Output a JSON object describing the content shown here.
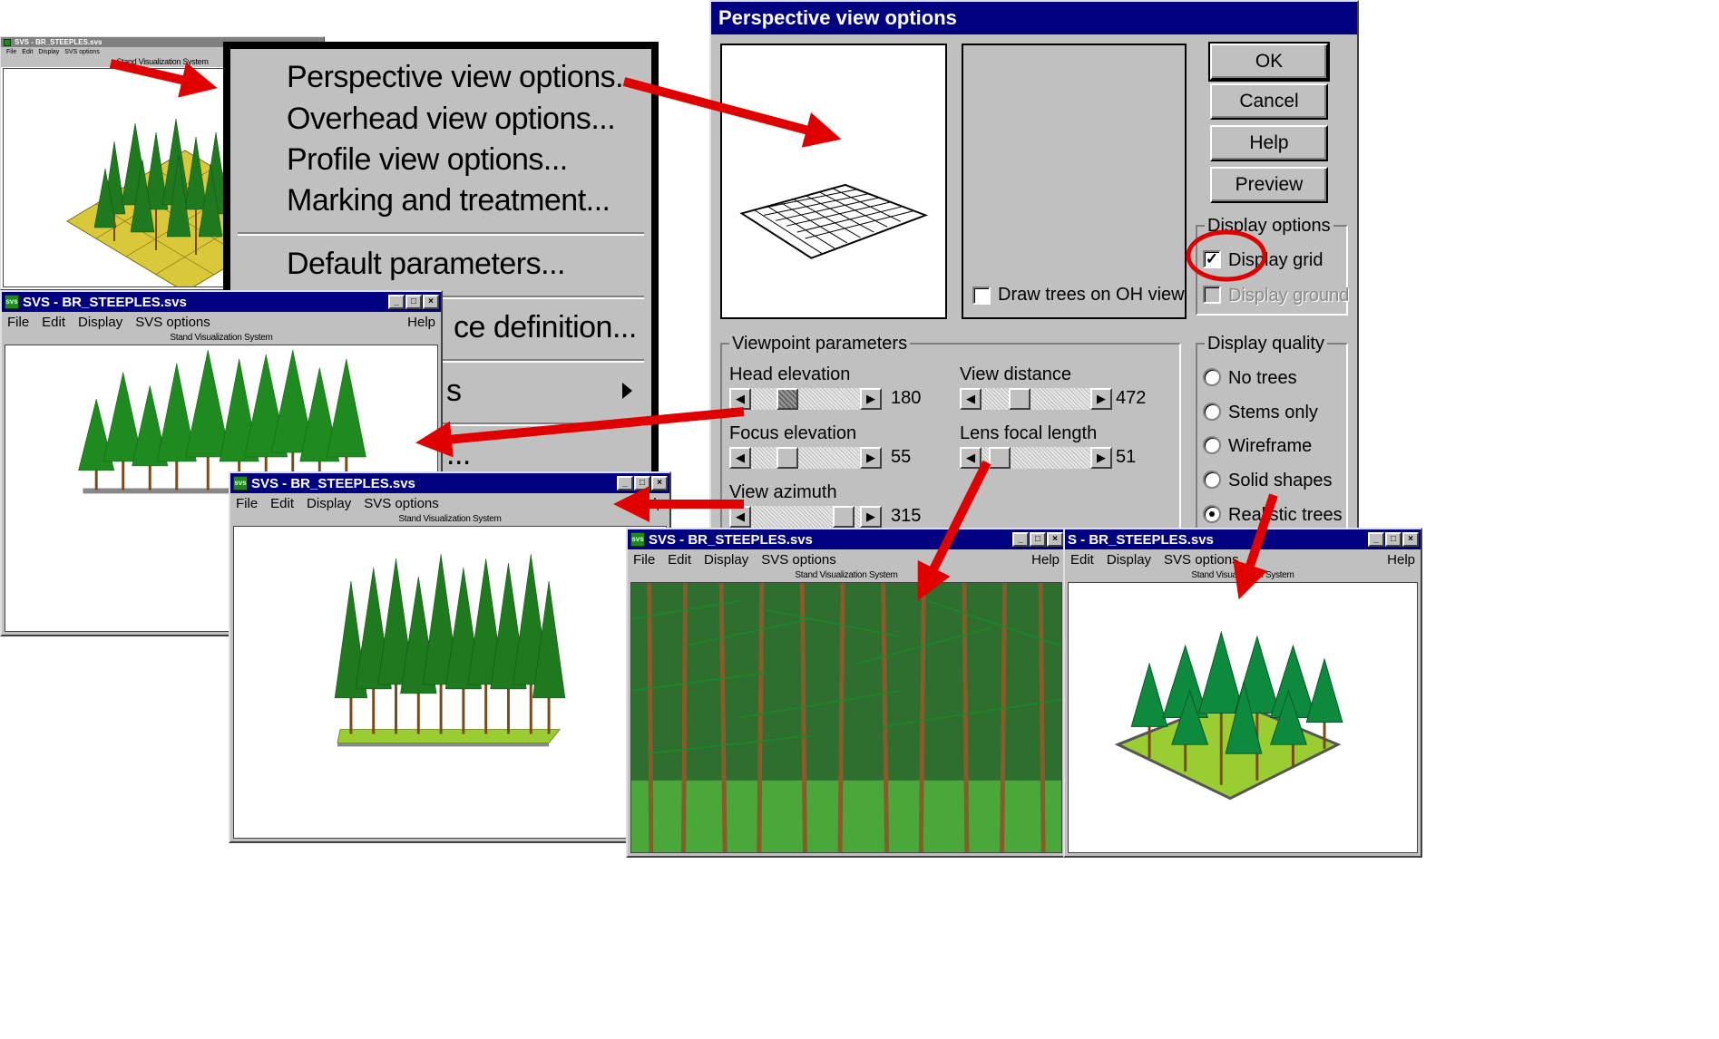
{
  "app": {
    "title": "SVS - BR_STEEPLES.svs",
    "subtitle": "Stand Visualization System",
    "title_cut": "S - BR_STEEPLES.svs"
  },
  "menubar": {
    "file": "File",
    "edit": "Edit",
    "display": "Display",
    "svs_options": "SVS options",
    "help": "Help",
    "edit_cut": "Edit"
  },
  "display_menu": {
    "items": [
      "Perspective view options...",
      "Overhead view options...",
      "Profile view options...",
      "Marking and treatment...",
      "Default parameters...",
      "ce definition...",
      "s",
      "..."
    ]
  },
  "dialog": {
    "title": "Perspective view options",
    "buttons": {
      "ok": "OK",
      "cancel": "Cancel",
      "help": "Help",
      "preview": "Preview"
    },
    "draw_trees_oh": "Draw trees on OH view",
    "display_options": {
      "label": "Display options",
      "grid": "Display grid",
      "ground": "Display ground",
      "grid_checked": true,
      "ground_checked": false
    },
    "viewpoint": {
      "label": "Viewpoint parameters",
      "head_elevation": {
        "label": "Head elevation",
        "value": "180"
      },
      "focus_elevation": {
        "label": "Focus elevation",
        "value": "55"
      },
      "view_azimuth": {
        "label": "View azimuth",
        "value": "315"
      },
      "view_distance": {
        "label": "View distance",
        "value": "472"
      },
      "lens_focal_length": {
        "label": "Lens focal length",
        "value": "51"
      }
    },
    "display_quality": {
      "label": "Display quality",
      "options": [
        "No trees",
        "Stems only",
        "Wireframe",
        "Solid shapes",
        "Realistic trees"
      ],
      "selected": "Realistic trees"
    }
  },
  "colors": {
    "titlebar": "#000080",
    "arrow": "#e00000",
    "foliage": "#1f7a1f",
    "ground": "#9acd32",
    "face": "#c0c0c0"
  }
}
